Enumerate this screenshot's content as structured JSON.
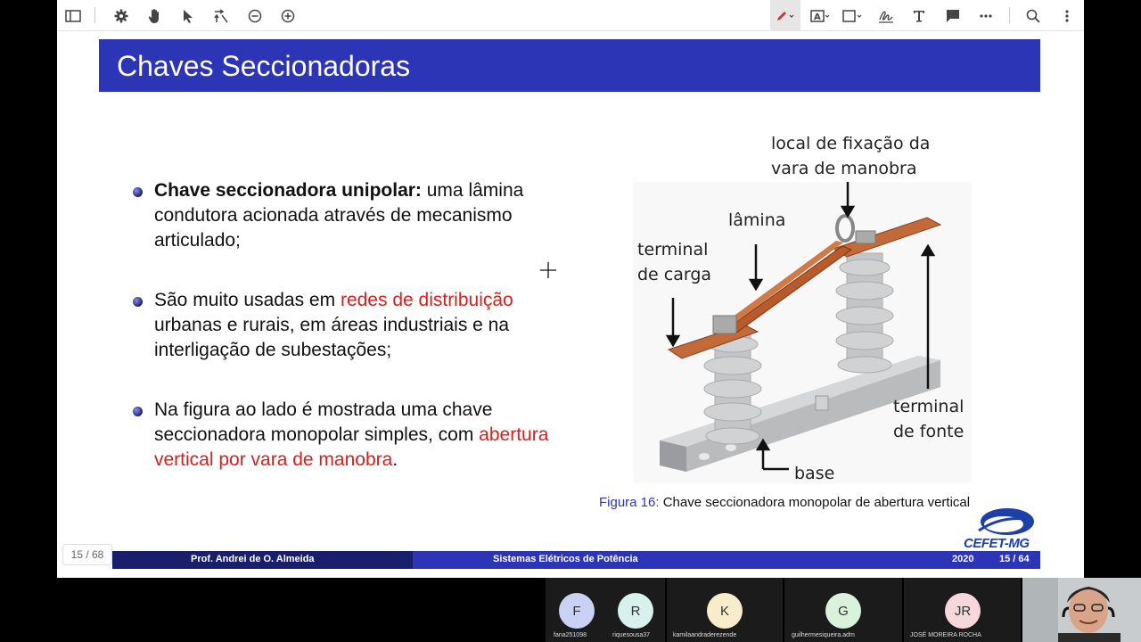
{
  "toolbar": {
    "items": [
      "sidebar-toggle-icon",
      "settings-icon",
      "hand-icon",
      "pointer-icon",
      "rotate-icon",
      "zoom-out-icon",
      "zoom-in-icon",
      "highlight-icon",
      "text-icon",
      "shape-icon",
      "signature-icon",
      "type-icon",
      "comment-icon",
      "more-icon",
      "search-icon",
      "menu-icon"
    ]
  },
  "slide": {
    "title": "Chaves Seccionadoras",
    "bullets": [
      {
        "bold": "Chave seccionadora unipolar:",
        "text": " uma lâmina condutora acionada através de mecanismo articulado;"
      },
      {
        "pre": "São muito usadas em ",
        "red": "redes de distribuição",
        "post": " urbanas e rurais, em áreas industriais e na interligação de subestações;"
      },
      {
        "pre": "Na figura ao lado é mostrada uma chave seccionadora monopolar simples, com ",
        "red": "abertura vertical por vara de manobra",
        "post": "."
      }
    ],
    "figure_labels": {
      "fixacao": "local de fixação da\nvara de manobra",
      "lamina": "lâmina",
      "terminal_carga": "terminal\nde carga",
      "terminal_fonte": "terminal\nde fonte",
      "base": "base"
    },
    "caption_fig": "Figura 16:",
    "caption_text": " Chave seccionadora monopolar de abertura vertical",
    "logo": "CEFET-MG",
    "footer": {
      "author": "Prof. Andrei de O. Almeida",
      "course": "Sistemas Elétricos de Potência",
      "year": "2020",
      "page": "15 / 64"
    }
  },
  "page_indicator": "15 / 68",
  "participants": [
    {
      "initial": "F",
      "name": "fana251098",
      "color": "#c9d2f5"
    },
    {
      "initial": "R",
      "name": "riquesousa37",
      "color": "#d8f0ee"
    },
    {
      "initial": "K",
      "name": "kamilaandraderezende",
      "color": "#f9eccb"
    },
    {
      "initial": "G",
      "name": "guilhermesiqueira.adm",
      "color": "#daf2dc"
    },
    {
      "initial": "JR",
      "name": "JOSÉ MOREIRA ROCHA",
      "color": "#f5d7dc"
    }
  ]
}
